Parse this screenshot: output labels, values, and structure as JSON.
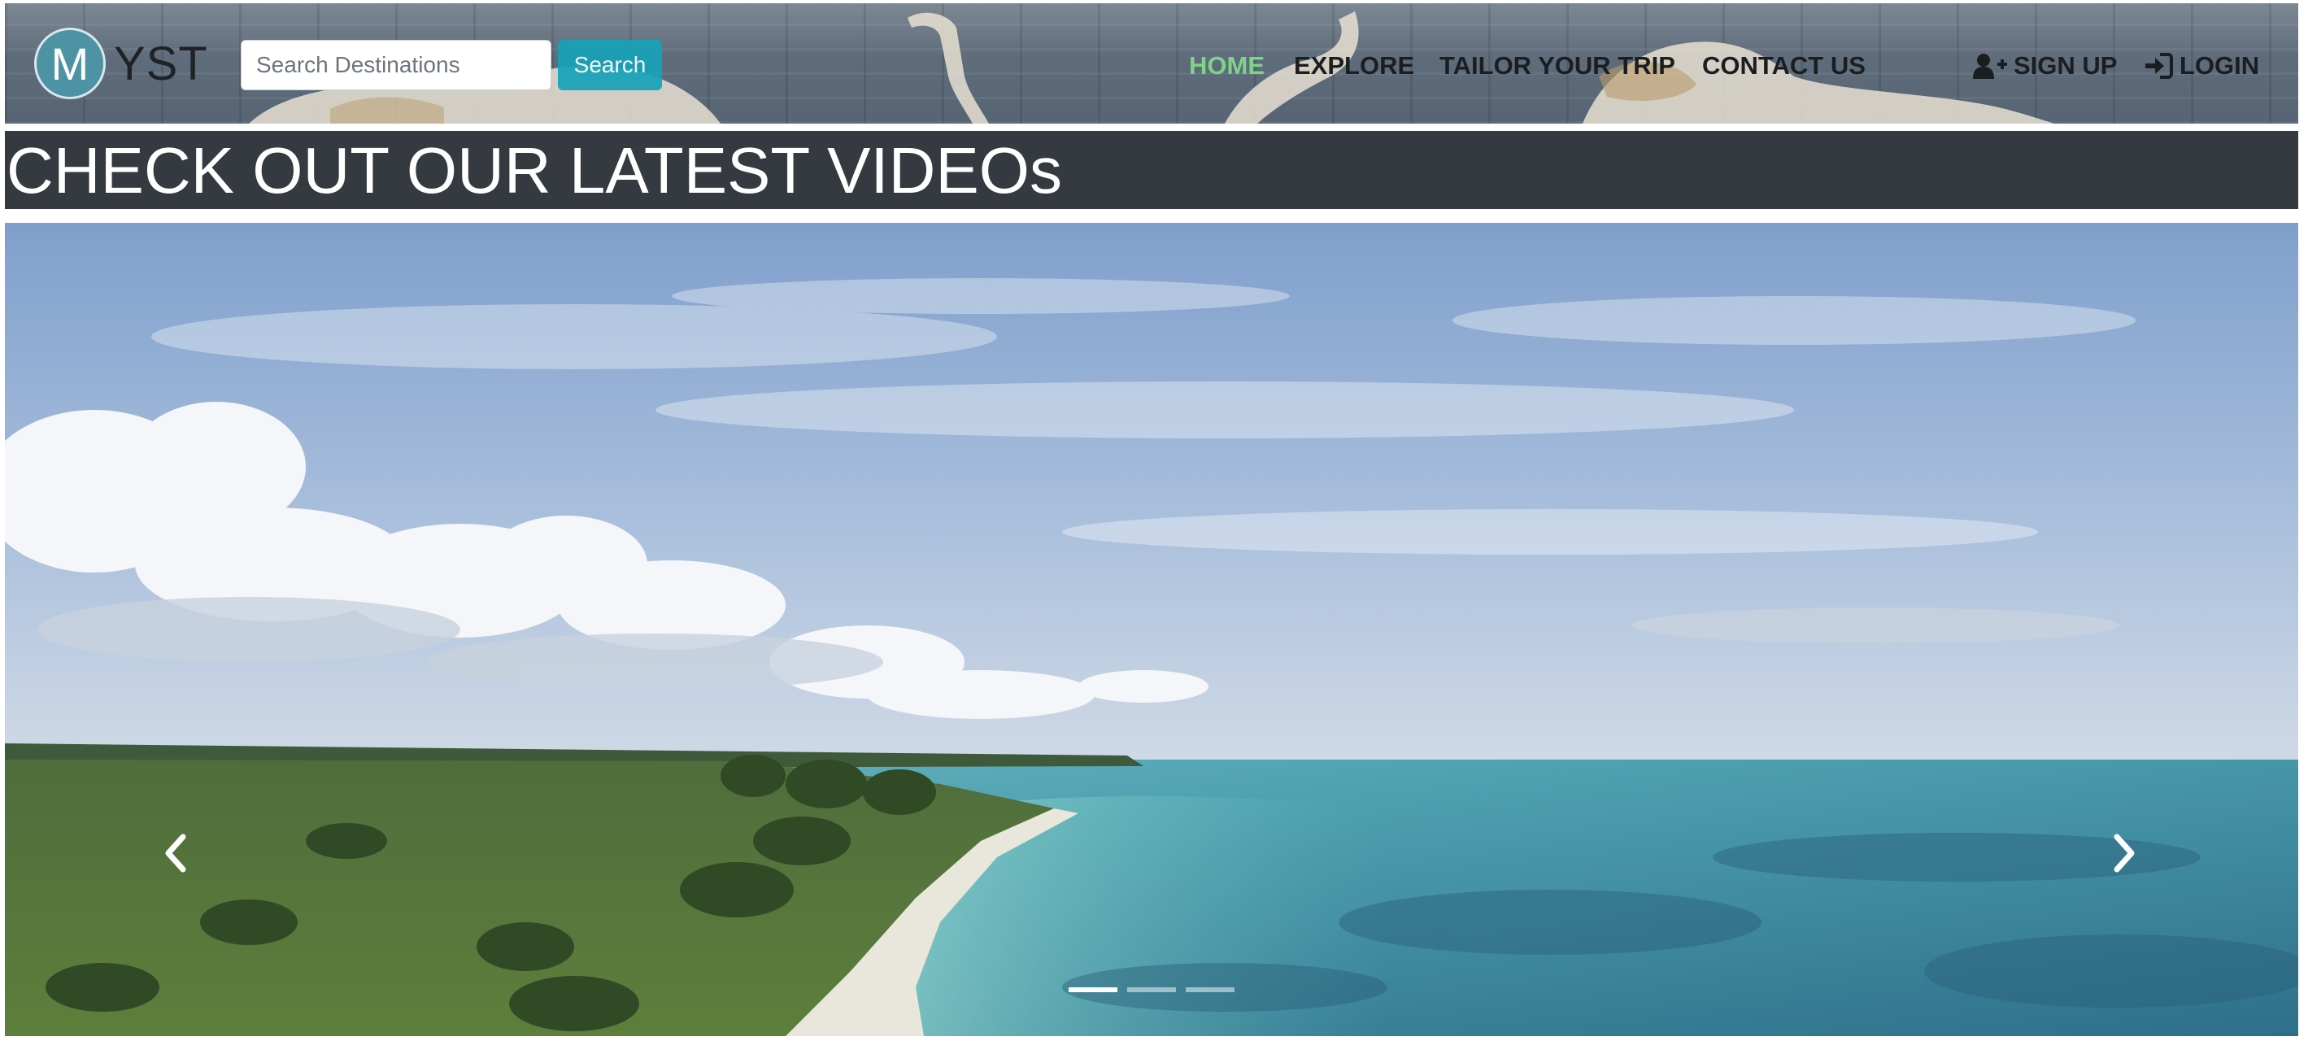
{
  "brand": {
    "logo_letter": "M",
    "name": "YST"
  },
  "search": {
    "placeholder": "Search Destinations",
    "button_label": "Search",
    "value": ""
  },
  "nav": {
    "items": [
      {
        "label": "HOME",
        "active": true
      },
      {
        "label": "EXPLORE",
        "active": false
      },
      {
        "label": "TAILOR YOUR TRIP",
        "active": false
      },
      {
        "label": "CONTACT US",
        "active": false
      }
    ],
    "signup_label": "SIGN UP",
    "login_label": "LOGIN"
  },
  "section": {
    "heading": "CHECK OUT OUR LATEST VIDEOs"
  },
  "carousel": {
    "slide_count": 3,
    "active_index": 0,
    "icons": {
      "prev": "chevron-left-icon",
      "next": "chevron-right-icon"
    }
  },
  "colors": {
    "active_nav": "#7dd387",
    "heading_bar": "#343a40",
    "search_button": "#17a2b8",
    "logo": "#4e93a4"
  }
}
